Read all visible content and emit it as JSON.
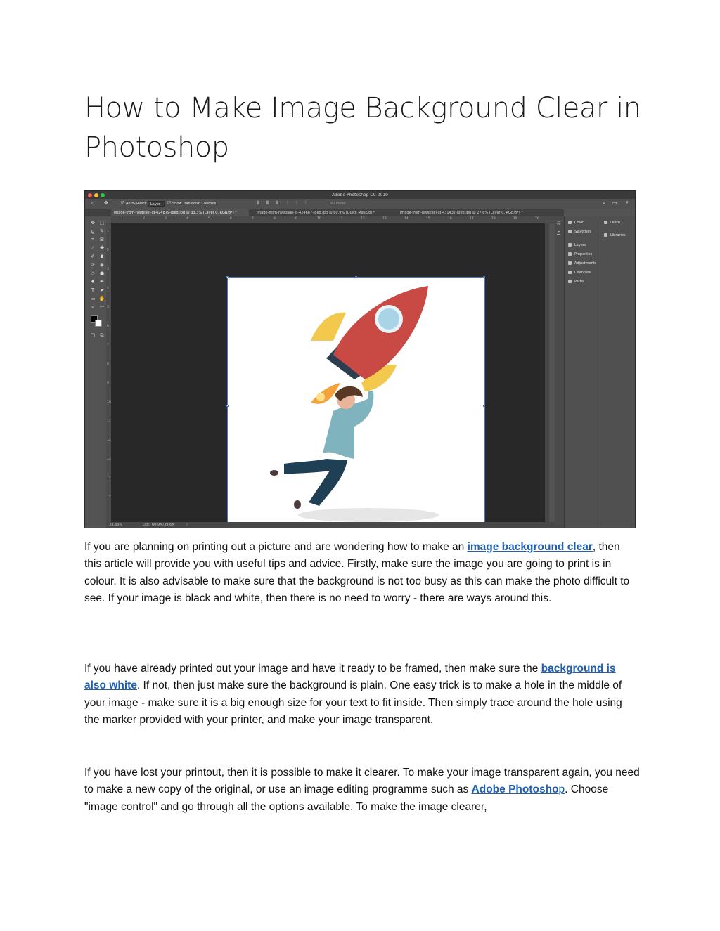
{
  "article": {
    "title": "How to Make Image Background Clear in Photoshop",
    "p1": {
      "before": "If you are planning on printing out a picture and are wondering how to make an ",
      "link": "image background clear",
      "after": ", then this article will provide you with useful tips and advice. Firstly, make sure the image you are going to print is in colour. It is also advisable to make sure that the background is not too busy as this can make the photo difficult to see. If your image is black and white, then there is no need to worry - there are ways around this."
    },
    "p2": {
      "before": "If you have already printed out your image and have it ready to be framed, then make sure the ",
      "link": "background is also white",
      "after": ". If not, then just make sure the background is plain. One easy trick is to make a hole in the middle of your image - make sure it is a big enough size for your text to fit inside. Then simply trace around the hole using the marker provided with your printer, and make your image transparent."
    },
    "p3": {
      "before": "If you have lost your printout, then it is possible to make it clearer. To make your image transparent again, you need to make a new copy of the original, or use an image editing programme such as ",
      "link_bold": "Adobe Photosho",
      "link_regular": "p",
      "after": ". Choose \"image control\" and go through all the options available. To make the image clearer,"
    },
    "link_color": "#1f5fae"
  },
  "photoshop": {
    "app_title": "Adobe Photoshop CC 2019",
    "options": {
      "auto_select": "Auto-Select:",
      "layer_select": "Layer",
      "show_transform": "Show Transform Controls",
      "mode_3d": "3D Mode:"
    },
    "tabs": [
      "image-from-rawpixel-id-424879-jpeg.jpg @ 33.3% (Layer 0, RGB/8*) *",
      "image-from-rawpixel-id-424687-jpeg.jpg @ 80.9% (Quick Mask/8) *",
      "image-from-rawpixel-id-431437-jpeg.jpg @ 27.8% (Layer 0, RGB/8*) *"
    ],
    "ruler_top": [
      "1",
      "2",
      "3",
      "4",
      "5",
      "6",
      "7",
      "8",
      "9",
      "10",
      "11",
      "12",
      "13",
      "14",
      "15",
      "16",
      "17",
      "18",
      "19",
      "20"
    ],
    "ruler_left": [
      "1",
      "2",
      "3",
      "4",
      "5",
      "6",
      "7",
      "8",
      "9",
      "10",
      "11",
      "12",
      "13",
      "14",
      "15"
    ],
    "status": {
      "zoom": "33.33%",
      "doc": "Doc: 60.9M/39.6M"
    },
    "panels_left": [
      "Color",
      "Swatches",
      "Layers",
      "Properties",
      "Adjustments",
      "Channels",
      "Paths"
    ],
    "panels_right": [
      "Learn",
      "Libraries"
    ],
    "colors": {
      "rocket_body": "#c94a44",
      "rocket_fin": "#f2c94c",
      "rocket_dark": "#2c3e50",
      "window_glass": "#a8d4e6",
      "flame": "#f4a23c",
      "shirt": "#7fb3bd",
      "pants": "#1f3f55",
      "hair": "#5a3826",
      "shadow": "#e6e6e6"
    }
  }
}
